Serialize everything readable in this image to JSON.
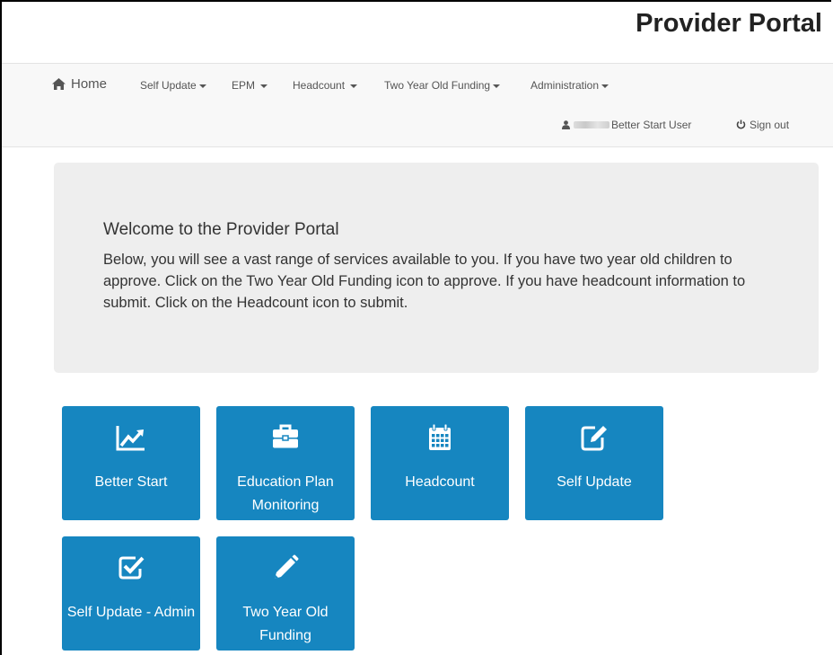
{
  "header": {
    "title": "Provider Portal"
  },
  "navbar": {
    "home": "Home",
    "menus": [
      {
        "label": "Self Update"
      },
      {
        "label": "EPM"
      },
      {
        "label": "Headcount"
      },
      {
        "label": "Two Year Old Funding"
      },
      {
        "label": "Administration"
      }
    ],
    "user": {
      "role": "Better Start User",
      "icon": "user-icon"
    },
    "sign_out": "Sign out"
  },
  "welcome": {
    "title": "Welcome to the Provider Portal",
    "text": "Below, you will see a vast range of services available to you. If you have two year old children to approve. Click on the Two Year Old Funding icon to approve. If you have headcount information to submit. Click on the Headcount icon to submit."
  },
  "tiles": [
    {
      "label": "Better Start",
      "icon": "line-chart-icon"
    },
    {
      "label": "Education Plan Monitoring",
      "icon": "briefcase-icon"
    },
    {
      "label": "Headcount",
      "icon": "calendar-icon"
    },
    {
      "label": "Self Update",
      "icon": "edit-icon"
    },
    {
      "label": "Self Update - Admin",
      "icon": "checkbox-icon"
    },
    {
      "label": "Two Year Old Funding",
      "icon": "pencil-icon"
    }
  ],
  "colors": {
    "tile": "#1686c0",
    "navbar": "#f8f8f8",
    "jumbotron": "#eeeeee"
  }
}
